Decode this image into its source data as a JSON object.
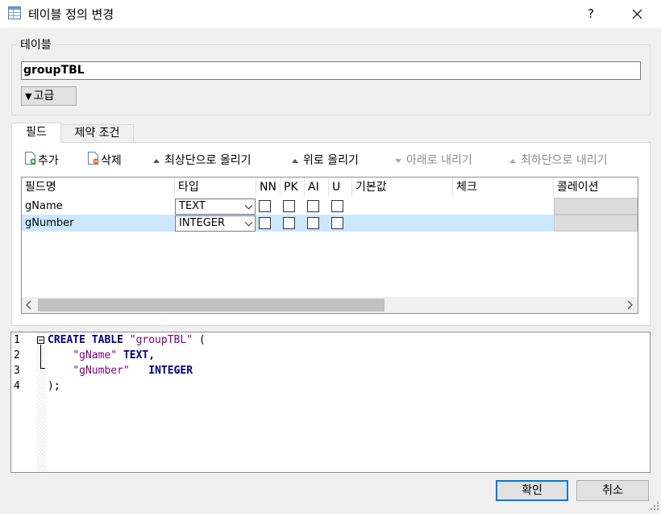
{
  "window": {
    "title": "테이블 정의 변경",
    "help_label": "?",
    "close_label": "✕"
  },
  "table_group": {
    "legend": "테이블",
    "name_value": "groupTBL",
    "advanced_label": "고급"
  },
  "tabs": [
    {
      "label": "필드",
      "selected": true
    },
    {
      "label": "제약 조건",
      "selected": false
    }
  ],
  "toolbar": {
    "add": "추가",
    "delete": "삭제",
    "move_top": "최상단으로 올리기",
    "move_up": "위로 올리기",
    "move_down": "아래로 내리기",
    "move_bottom": "최하단으로 내리기"
  },
  "grid": {
    "columns": [
      "필드명",
      "타입",
      "NN",
      "PK",
      "AI",
      "U",
      "기본값",
      "체크",
      "콜레이션"
    ],
    "rows": [
      {
        "name": "gName",
        "type": "TEXT",
        "nn": false,
        "pk": false,
        "ai": false,
        "u": false
      },
      {
        "name": "gNumber",
        "type": "INTEGER",
        "nn": false,
        "pk": false,
        "ai": false,
        "u": false
      }
    ],
    "selected_row": 1
  },
  "sql": {
    "line_numbers": [
      "1",
      "2",
      "3",
      "4"
    ],
    "tokens": {
      "create_table": "CREATE TABLE",
      "table_name": "\"groupTBL\"",
      "open_paren": " (",
      "col1_name": "\"gName\"",
      "col1_type": "TEXT,",
      "col2_name": "\"gNumber\"",
      "col2_type": "INTEGER",
      "close": ");"
    },
    "colors": {
      "keyword": "#00007f",
      "string": "#7f007f"
    }
  },
  "buttons": {
    "ok": "확인",
    "cancel": "취소"
  },
  "colors": {
    "selection": "#cce8ff",
    "primary_border": "#0078d7"
  }
}
